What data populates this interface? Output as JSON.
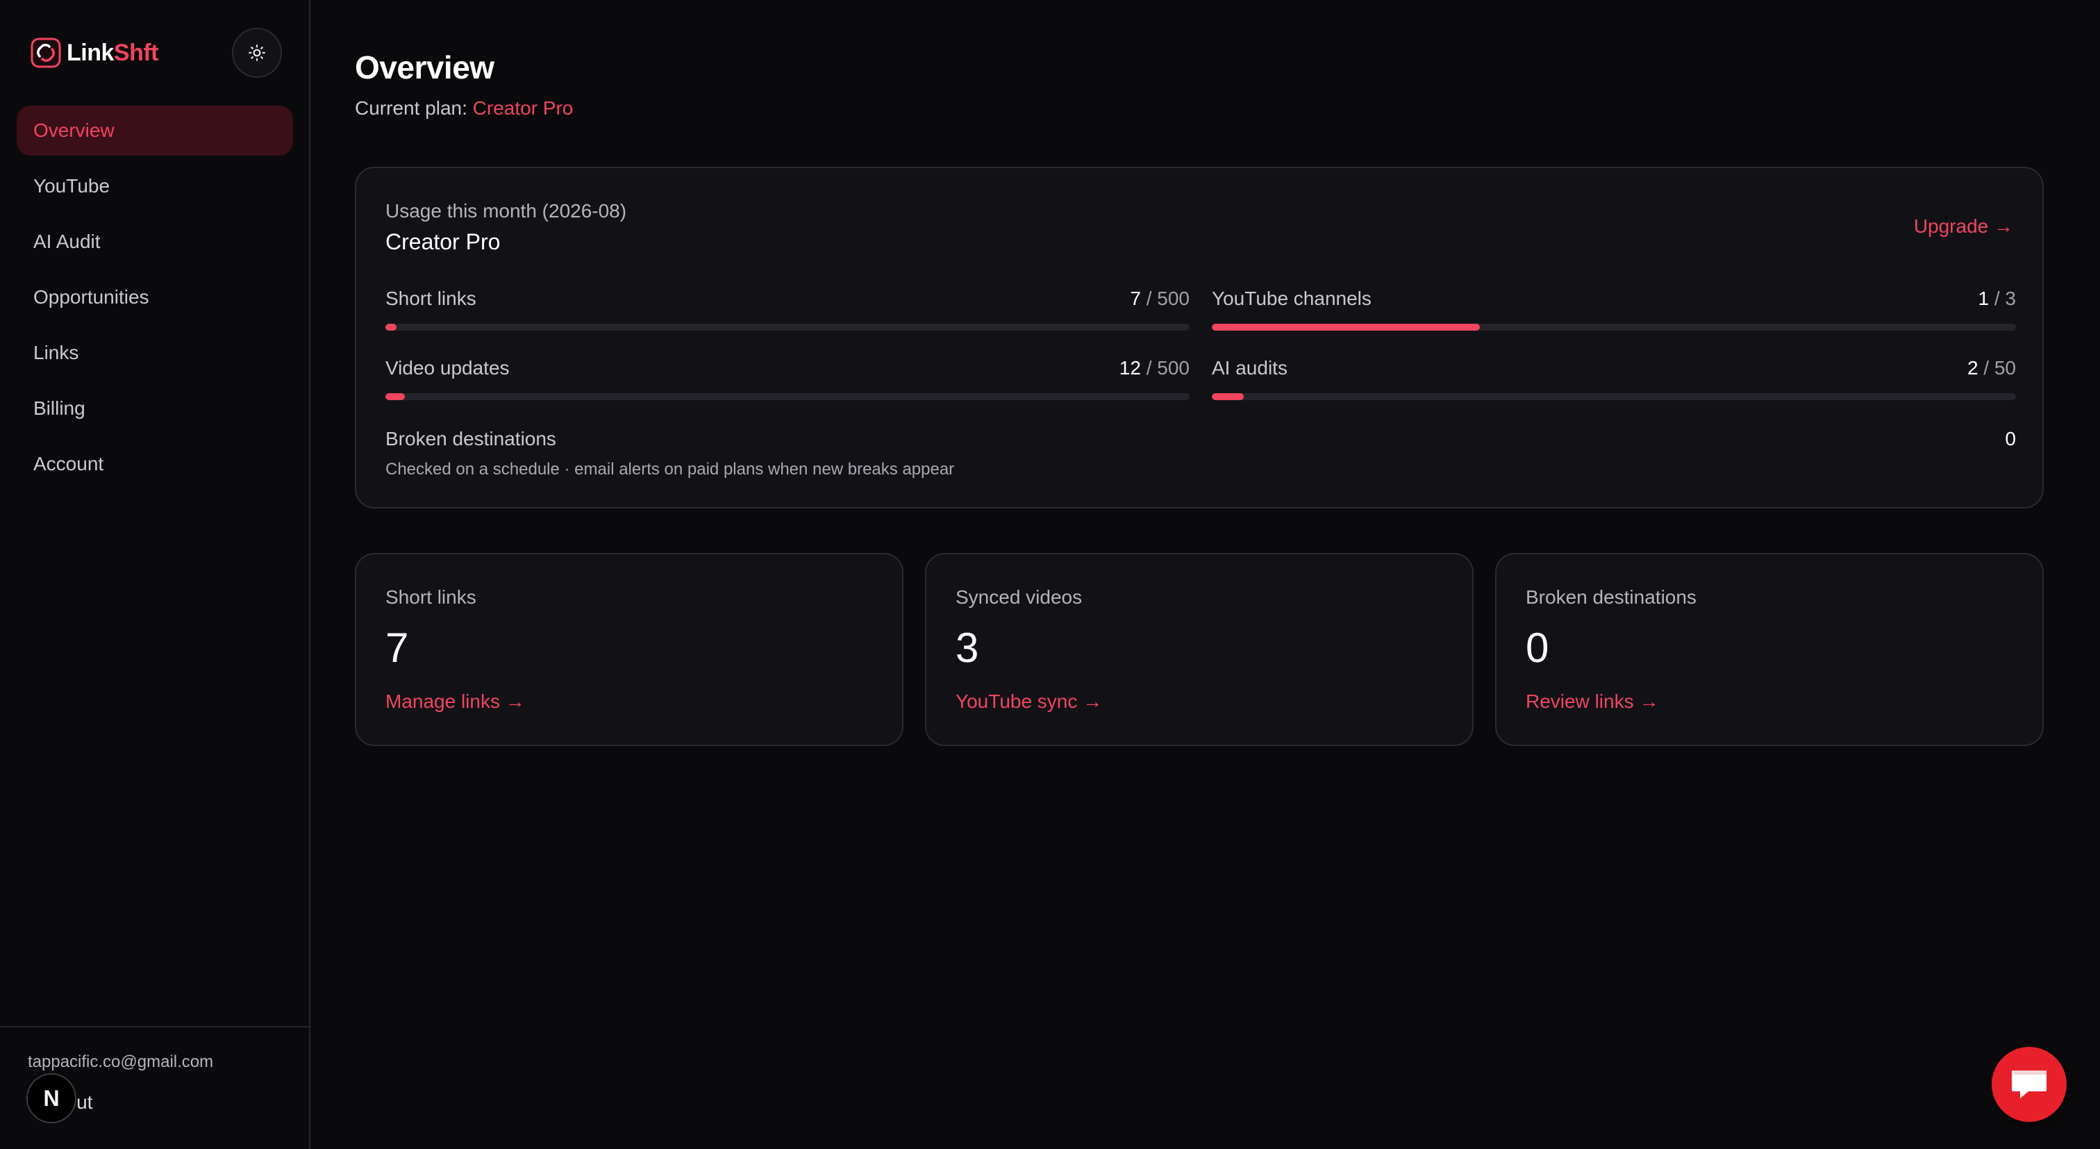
{
  "brand": {
    "name_part1": "Link",
    "name_part2": "Shft",
    "accent": "#f0445f"
  },
  "sidebar": {
    "items": [
      {
        "label": "Overview",
        "active": true
      },
      {
        "label": "YouTube"
      },
      {
        "label": "AI Audit"
      },
      {
        "label": "Opportunities"
      },
      {
        "label": "Links"
      },
      {
        "label": "Billing"
      },
      {
        "label": "Account"
      }
    ],
    "user_email": "tappacific.co@gmail.com",
    "logout_label": "Log out",
    "n_badge": "N"
  },
  "header": {
    "title": "Overview",
    "plan_prefix": "Current plan:",
    "plan_name": "Creator Pro"
  },
  "usage": {
    "period_label": "Usage this month (2026-08)",
    "plan_name": "Creator Pro",
    "upgrade_label": "Upgrade →",
    "metrics": [
      {
        "label": "Short links",
        "used": "7",
        "limit": "/ 500",
        "fraction": 0.014
      },
      {
        "label": "YouTube channels",
        "used": "1",
        "limit": "/ 3",
        "fraction": 0.333
      },
      {
        "label": "Video updates",
        "used": "12",
        "limit": "/ 500",
        "fraction": 0.024
      },
      {
        "label": "AI audits",
        "used": "2",
        "limit": "/ 50",
        "fraction": 0.04
      }
    ],
    "broken": {
      "label": "Broken destinations",
      "count": "0",
      "note": "Checked on a schedule · email alerts on paid plans when new breaks appear"
    }
  },
  "stats": [
    {
      "label": "Short links",
      "value": "7",
      "link": "Manage links →"
    },
    {
      "label": "Synced videos",
      "value": "3",
      "link": "YouTube sync →"
    },
    {
      "label": "Broken destinations",
      "value": "0",
      "link": "Review links →"
    }
  ]
}
